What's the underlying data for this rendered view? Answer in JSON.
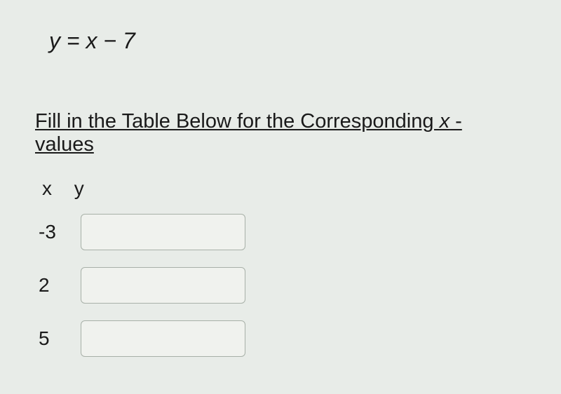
{
  "equation": "y = x − 7",
  "instruction_prefix": "Fill in the Table Below for the Corresponding ",
  "instruction_var": "x",
  "instruction_suffix": " - values",
  "columns": {
    "x": "x",
    "y": "y"
  },
  "rows": [
    {
      "x": "-3",
      "y": ""
    },
    {
      "x": "2",
      "y": ""
    },
    {
      "x": "5",
      "y": ""
    }
  ]
}
